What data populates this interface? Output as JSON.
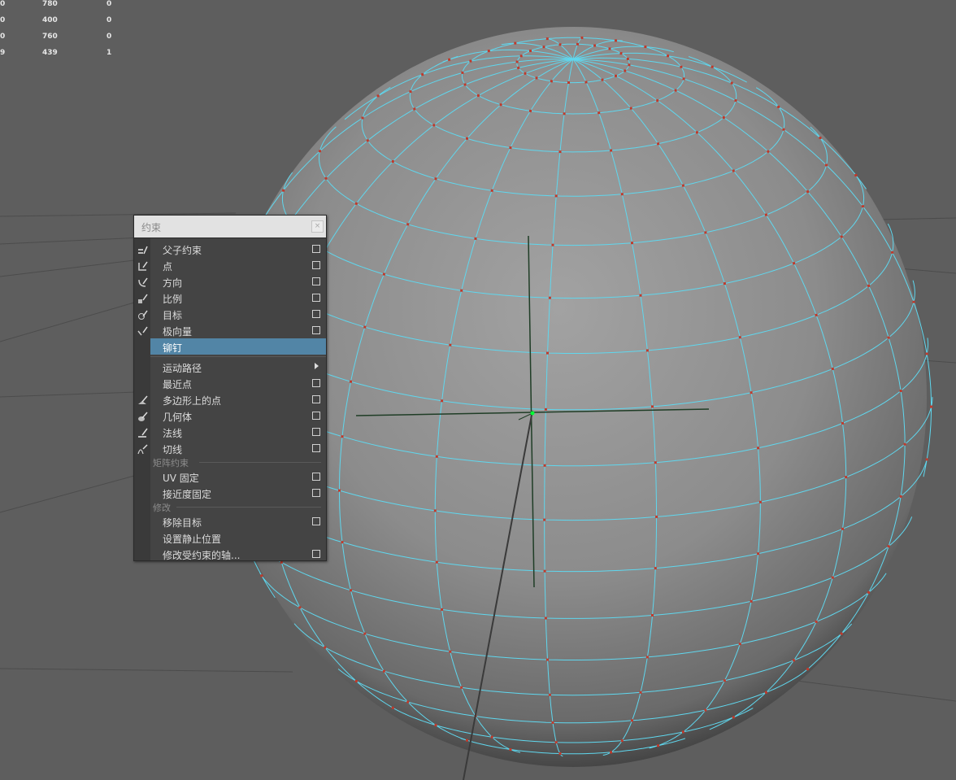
{
  "hud": {
    "rows": [
      [
        "0",
        "780",
        "0"
      ],
      [
        "0",
        "400",
        "0"
      ],
      [
        "0",
        "760",
        "0"
      ],
      [
        "9",
        "439",
        "1"
      ]
    ]
  },
  "constrain_menu": {
    "title": "约束",
    "close_glyph": "×",
    "items": [
      {
        "label": "父子约束",
        "icon": "parent-constraint-icon",
        "option_box": true
      },
      {
        "label": "点",
        "icon": "point-constraint-icon",
        "option_box": true
      },
      {
        "label": "方向",
        "icon": "orient-constraint-icon",
        "option_box": true
      },
      {
        "label": "比例",
        "icon": "scale-constraint-icon",
        "option_box": true
      },
      {
        "label": "目标",
        "icon": "aim-constraint-icon",
        "option_box": true
      },
      {
        "label": "极向量",
        "icon": "pole-vector-constraint-icon",
        "option_box": true
      },
      {
        "label": "铆钉",
        "highlighted": true
      },
      {
        "label": "运动路径",
        "submenu": true
      },
      {
        "label": "最近点",
        "option_box": true
      },
      {
        "label": "多边形上的点",
        "icon": "point-on-poly-icon",
        "option_box": true
      },
      {
        "label": "几何体",
        "icon": "geometry-constraint-icon",
        "option_box": true
      },
      {
        "label": "法线",
        "icon": "normal-constraint-icon",
        "option_box": true
      },
      {
        "label": "切线",
        "icon": "tangent-constraint-icon",
        "option_box": true
      }
    ],
    "matrix_section": {
      "label": "矩阵约束",
      "items": [
        {
          "label": "UV 固定",
          "option_box": true
        },
        {
          "label": "接近度固定",
          "option_box": true
        }
      ]
    },
    "modify_section": {
      "label": "修改",
      "items": [
        {
          "label": "移除目标",
          "option_box": true
        },
        {
          "label": "设置静止位置"
        },
        {
          "label": "修改受约束的轴...",
          "option_box": true
        }
      ]
    }
  },
  "colors": {
    "viewport_bg": "#5e5e5e",
    "wireframe": "#5fd7ee",
    "vertex": "#c0392b",
    "highlight": "#5285a6",
    "pivot": "#00ff33"
  }
}
